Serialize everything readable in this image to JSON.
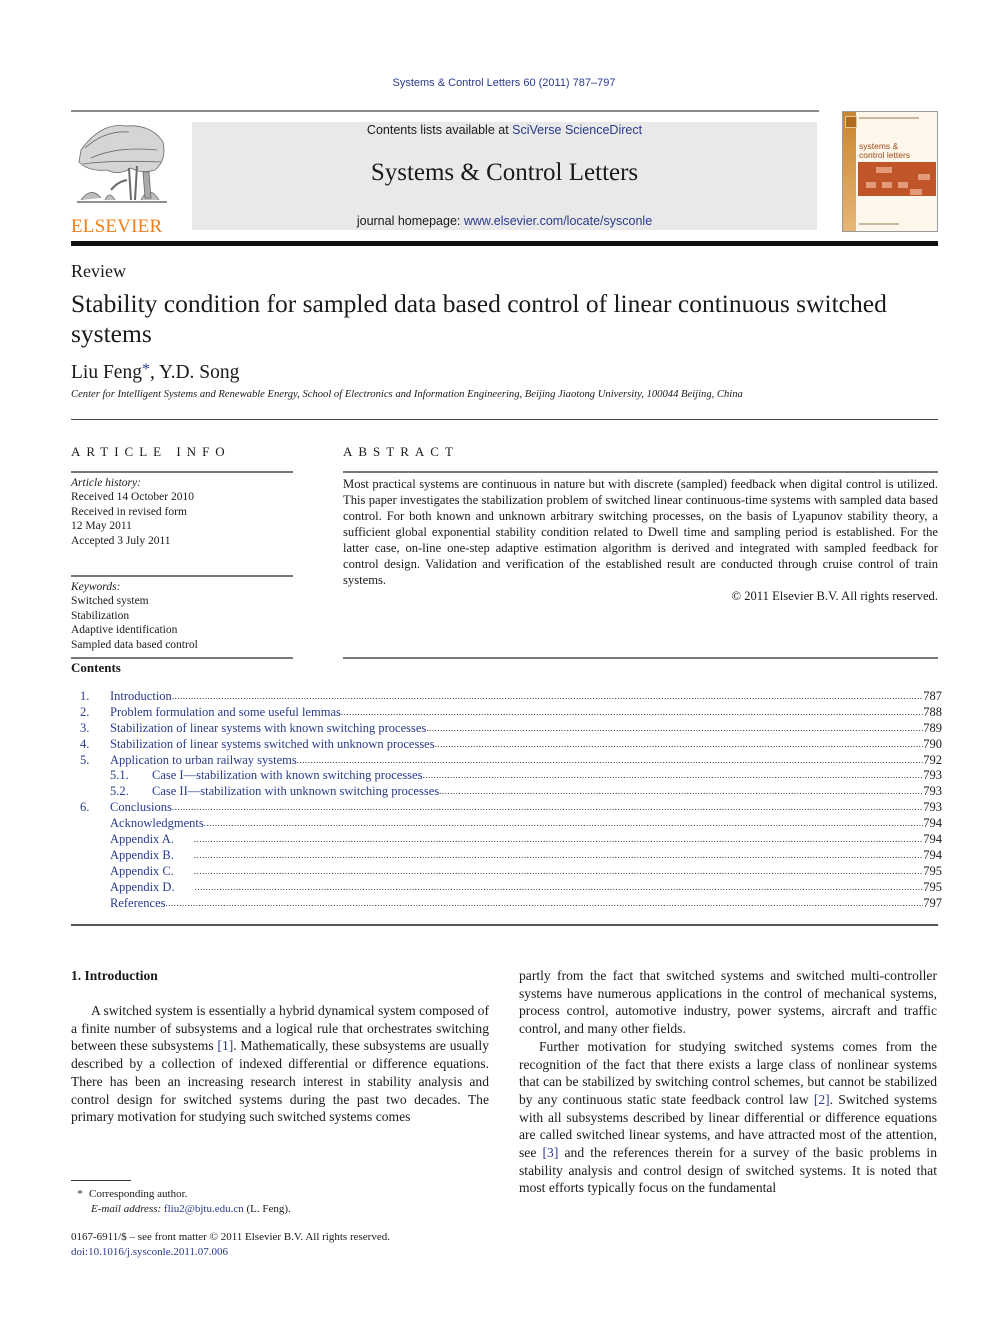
{
  "running_head": "Systems & Control Letters 60 (2011) 787–797",
  "publisher": {
    "name": "ELSEVIER",
    "brand_color": "#f07f1a"
  },
  "masthead": {
    "contents_prefix": "Contents lists available at ",
    "contents_link": "SciVerse ScienceDirect",
    "journal_title": "Systems & Control Letters",
    "homepage_prefix": "journal homepage: ",
    "homepage_link": "www.elsevier.com/locate/sysconle"
  },
  "cover": {
    "title_line1": "systems &",
    "title_line2": "control letters"
  },
  "article": {
    "type": "Review",
    "title": "Stability condition for sampled data based control of linear continuous switched systems",
    "authors": {
      "first": "Liu Feng",
      "marker": "*",
      "rest": ", Y.D. Song"
    },
    "affiliation": "Center for Intelligent Systems and Renewable Energy, School of Electronics and Information Engineering, Beijing Jiaotong University, 100044 Beijing, China"
  },
  "article_info": {
    "heading": "ARTICLE INFO",
    "history_label": "Article history:",
    "history": [
      "Received 14 October 2010",
      "Received in revised form",
      "12 May 2011",
      "Accepted 3 July 2011"
    ],
    "keywords_label": "Keywords:",
    "keywords": [
      "Switched system",
      "Stabilization",
      "Adaptive identification",
      "Sampled data based control"
    ]
  },
  "abstract": {
    "heading": "ABSTRACT",
    "text": "Most practical systems are continuous in nature but with discrete (sampled) feedback when digital control is utilized. This paper investigates the stabilization problem of switched linear continuous-time systems with sampled data based control. For both known and unknown arbitrary switching processes, on the basis of Lyapunov stability theory, a sufficient global exponential stability condition related to Dwell time and sampling period is established. For the latter case, on-line one-step adaptive estimation algorithm is derived and integrated with sampled feedback for control design. Validation and verification of the established result are conducted through cruise control of train systems.",
    "copyright": "© 2011 Elsevier B.V. All rights reserved."
  },
  "contents": {
    "heading": "Contents",
    "items": [
      {
        "num": "1.",
        "title": "Introduction",
        "page": "787",
        "level": 1
      },
      {
        "num": "2.",
        "title": "Problem formulation and some useful lemmas",
        "page": "788",
        "level": 1
      },
      {
        "num": "3.",
        "title": "Stabilization of linear systems with known switching processes",
        "page": "789",
        "level": 1
      },
      {
        "num": "4.",
        "title": "Stabilization of linear systems switched with unknown processes",
        "page": "790",
        "level": 1
      },
      {
        "num": "5.",
        "title": "Application to urban railway systems",
        "page": "792",
        "level": 1
      },
      {
        "num": "5.1.",
        "title": "Case I—stabilization with known switching processes",
        "page": "793",
        "level": 2
      },
      {
        "num": "5.2.",
        "title": "Case II—stabilization with unknown switching processes",
        "page": "793",
        "level": 2
      },
      {
        "num": "6.",
        "title": "Conclusions",
        "page": "793",
        "level": 1
      },
      {
        "num": "",
        "title": "Acknowledgments",
        "page": "794",
        "level": 1
      },
      {
        "num": "",
        "title": "Appendix A.",
        "page": "794",
        "level": 1
      },
      {
        "num": "",
        "title": "Appendix B.",
        "page": "794",
        "level": 1
      },
      {
        "num": "",
        "title": "Appendix C.",
        "page": "795",
        "level": 1
      },
      {
        "num": "",
        "title": "Appendix D.",
        "page": "795",
        "level": 1
      },
      {
        "num": "",
        "title": "References",
        "page": "797",
        "level": 1
      }
    ]
  },
  "body": {
    "intro_heading": "1.  Introduction",
    "left_p1_a": "A switched system is essentially a hybrid dynamical system composed of a finite number of subsystems and a logical rule that orchestrates switching between these subsystems ",
    "ref1": "[1]",
    "left_p1_b": ". Mathematically, these subsystems are usually described by a collection of indexed differential or difference equations. There has been an increasing research interest in stability analysis and control design for switched systems during the past two decades. The primary motivation for studying such switched systems comes",
    "right_p1": "partly from the fact that switched systems and switched multi-controller systems have numerous applications in the control of mechanical systems, process control, automotive industry, power systems, aircraft and traffic control, and many other fields.",
    "right_p2_a": "Further motivation for studying switched systems comes from the recognition of the fact that there exists a large class of nonlinear systems that can be stabilized by switching control schemes, but cannot be stabilized by any continuous static state feedback control law ",
    "ref2": "[2]",
    "right_p2_b": ". Switched systems with all subsystems described by linear differential or difference equations are called switched linear systems, and have attracted most of the attention, see ",
    "ref3": "[3]",
    "right_p2_c": " and the references therein for a survey of the basic problems in stability analysis and control design of switched systems. It is noted that most efforts typically focus on the fundamental"
  },
  "footnote": {
    "marker": "*",
    "corresponding": "Corresponding author.",
    "email_label": "E-mail address:",
    "email": "fliu2@bjtu.edu.cn",
    "email_suffix": " (L. Feng)."
  },
  "front_matter": {
    "issn_line": "0167-6911/$ – see front matter © 2011 Elsevier B.V. All rights reserved.",
    "doi": "doi:10.1016/j.sysconle.2011.07.006"
  },
  "colors": {
    "link": "#2a3a8c",
    "masthead_bg": "#e9e9e9",
    "elsevier_orange": "#f07f1a"
  }
}
